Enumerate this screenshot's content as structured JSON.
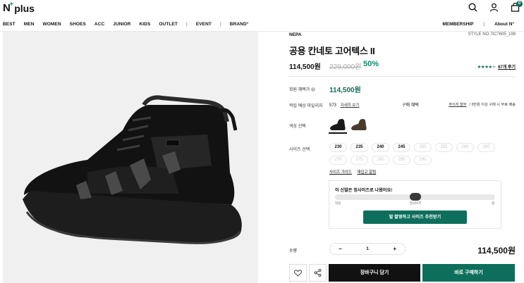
{
  "header": {
    "logo_letter": "N",
    "logo_plus": "+",
    "logo_word": "plus",
    "cart_count": "0",
    "icons": [
      "search-icon",
      "user-icon",
      "cart-icon"
    ]
  },
  "nav": {
    "left": [
      "BEST",
      "MEN",
      "WOMEN",
      "SHOES",
      "ACC",
      "JUNIOR",
      "KIDS",
      "OUTLET",
      "|",
      "EVENT",
      "|",
      "BRAND°"
    ],
    "right": [
      "MEMBERSHIP",
      "|",
      "About N°"
    ]
  },
  "product": {
    "brand": "NEPA",
    "style_no": "STYLE NO.7IC7605_199",
    "title": "공용 칸네토 고어텍스 II",
    "price": "114,500원",
    "original_price": "229,000원",
    "discount": "50%",
    "rating_stars": 4,
    "reviews_link": "67개 후기",
    "member_label": "회원 혜택가",
    "member_price": "114,500원",
    "mileage_label": "적립 예상 마일리지",
    "mileage_value": "573",
    "mileage_link": "자세히 보기",
    "benefit_label": "구매 혜택",
    "benefit_link": "무이자 할부",
    "benefit_text": "/ 3만원 이상 구매 시 무료 배송",
    "color_label": "색상 선택",
    "colors": [
      {
        "name": "black",
        "selected": true
      },
      {
        "name": "brown",
        "selected": false
      }
    ],
    "size_label": "사이즈 선택",
    "sizes_available": [
      "230",
      "235",
      "240",
      "245"
    ],
    "sizes_unavailable": [
      "250",
      "255",
      "260",
      "265",
      "270",
      "275",
      "280",
      "285",
      "290"
    ],
    "size_guide_link": "사이즈 가이드",
    "fit_link": "재입고 알림",
    "fit_question": "이 신발은 정사이즈로 나왔어요!",
    "fit_labels": [
      "작음",
      "정사이즈",
      "큼"
    ],
    "fit_level": 0.5,
    "fit_cta": "발 촬영하고 사이즈 추천받기",
    "qty_label": "수량",
    "qty_minus": "−",
    "qty_value": "1",
    "qty_plus": "+",
    "total": "114,500원",
    "cart_button": "장바구니 담기",
    "buy_button": "바로 구매하기"
  },
  "colors": {
    "accent": "#0d6f5b",
    "discount": "#0d8a6d"
  }
}
